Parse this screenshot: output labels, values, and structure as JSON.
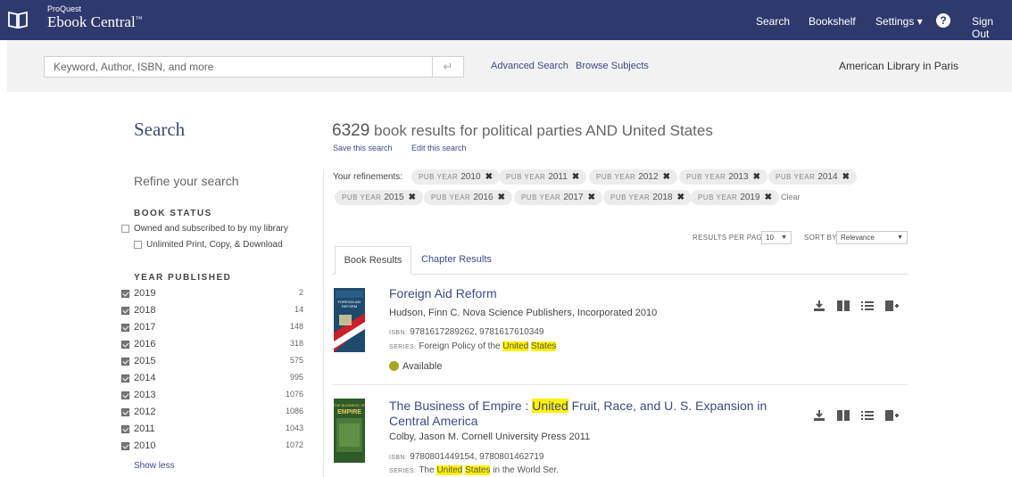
{
  "nav": {
    "brand_small": "ProQuest",
    "brand_big": "Ebook Central",
    "brand_tm": "™",
    "items": [
      "Search",
      "Bookshelf",
      "Settings ▾",
      "Sign Out"
    ],
    "help": "?"
  },
  "searchbar": {
    "placeholder": "Keyword, Author, ISBN, and more",
    "submit_icon": "↵",
    "advanced_label": "Advanced Search",
    "browse_label": "Browse Subjects",
    "library": "American Library in Paris"
  },
  "sidebar": {
    "title": "Search",
    "refine_title": "Refine your search",
    "book_status_heading": "BOOK STATUS",
    "status_options": [
      {
        "label": "Owned and subscribed to by my library",
        "checked": false
      },
      {
        "label": "Unlimited Print, Copy, & Download",
        "checked": false
      }
    ],
    "year_heading": "YEAR PUBLISHED",
    "years": [
      {
        "year": "2019",
        "count": "2"
      },
      {
        "year": "2018",
        "count": "14"
      },
      {
        "year": "2017",
        "count": "148"
      },
      {
        "year": "2016",
        "count": "318"
      },
      {
        "year": "2015",
        "count": "575"
      },
      {
        "year": "2014",
        "count": "995"
      },
      {
        "year": "2013",
        "count": "1076"
      },
      {
        "year": "2012",
        "count": "1086"
      },
      {
        "year": "2011",
        "count": "1043"
      },
      {
        "year": "2010",
        "count": "1072"
      }
    ],
    "show_less": "Show less"
  },
  "results": {
    "count": "6329",
    "heading_text": "book results for political parties AND United States",
    "save_search": "Save this search",
    "edit_search": "Edit this search",
    "refinements_label": "Your refinements:",
    "chip_key": "PUB YEAR",
    "chips": [
      "2010",
      "2011",
      "2012",
      "2013",
      "2014",
      "2015",
      "2016",
      "2017",
      "2018",
      "2019"
    ],
    "chip_close": "✖",
    "clear": "Clear",
    "per_page_label": "RESULTS PER PAGE",
    "per_page_value": "10",
    "sort_label": "SORT BY",
    "sort_value": "Relevance",
    "tabs": [
      "Book Results",
      "Chapter Results"
    ],
    "items": [
      {
        "title": "Foreign Aid Reform",
        "meta": "Hudson, Finn C.  Nova Science Publishers, Incorporated  2010",
        "isbn_label": "ISBN:",
        "isbn": "9781617289262, 9781617610349",
        "series_label": "SERIES:",
        "series_pre": "Foreign Policy of the ",
        "series_hl1": "United",
        "series_mid": " ",
        "series_hl2": "States",
        "series_post": "",
        "availability": "Available",
        "cover_text": "FOREIGN AID REFORM"
      },
      {
        "title_pre": "The Business of Empire : ",
        "title_hl": "United",
        "title_post": " Fruit, Race, and U. S. Expansion in Central America",
        "meta": "Colby, Jason M.  Cornell University Press  2011",
        "isbn_label": "ISBN:",
        "isbn": "9780801449154, 9780801462719",
        "series_label": "SERIES:",
        "series_pre": "The ",
        "series_hl1": "United",
        "series_mid": " ",
        "series_hl2": "States",
        "series_post": " in the World Ser.",
        "cover_text": "THE BUSINESS OF EMPIRE"
      }
    ]
  },
  "colors": {
    "nav_bg": "#2e3a6e",
    "link": "#3d4a8a",
    "highlight": "#fff200",
    "available": "#a8a820"
  },
  "icons": [
    "book-logo-icon",
    "help-icon",
    "return-icon",
    "download-icon",
    "read-icon",
    "list-icon",
    "add-to-bookshelf-icon"
  ]
}
